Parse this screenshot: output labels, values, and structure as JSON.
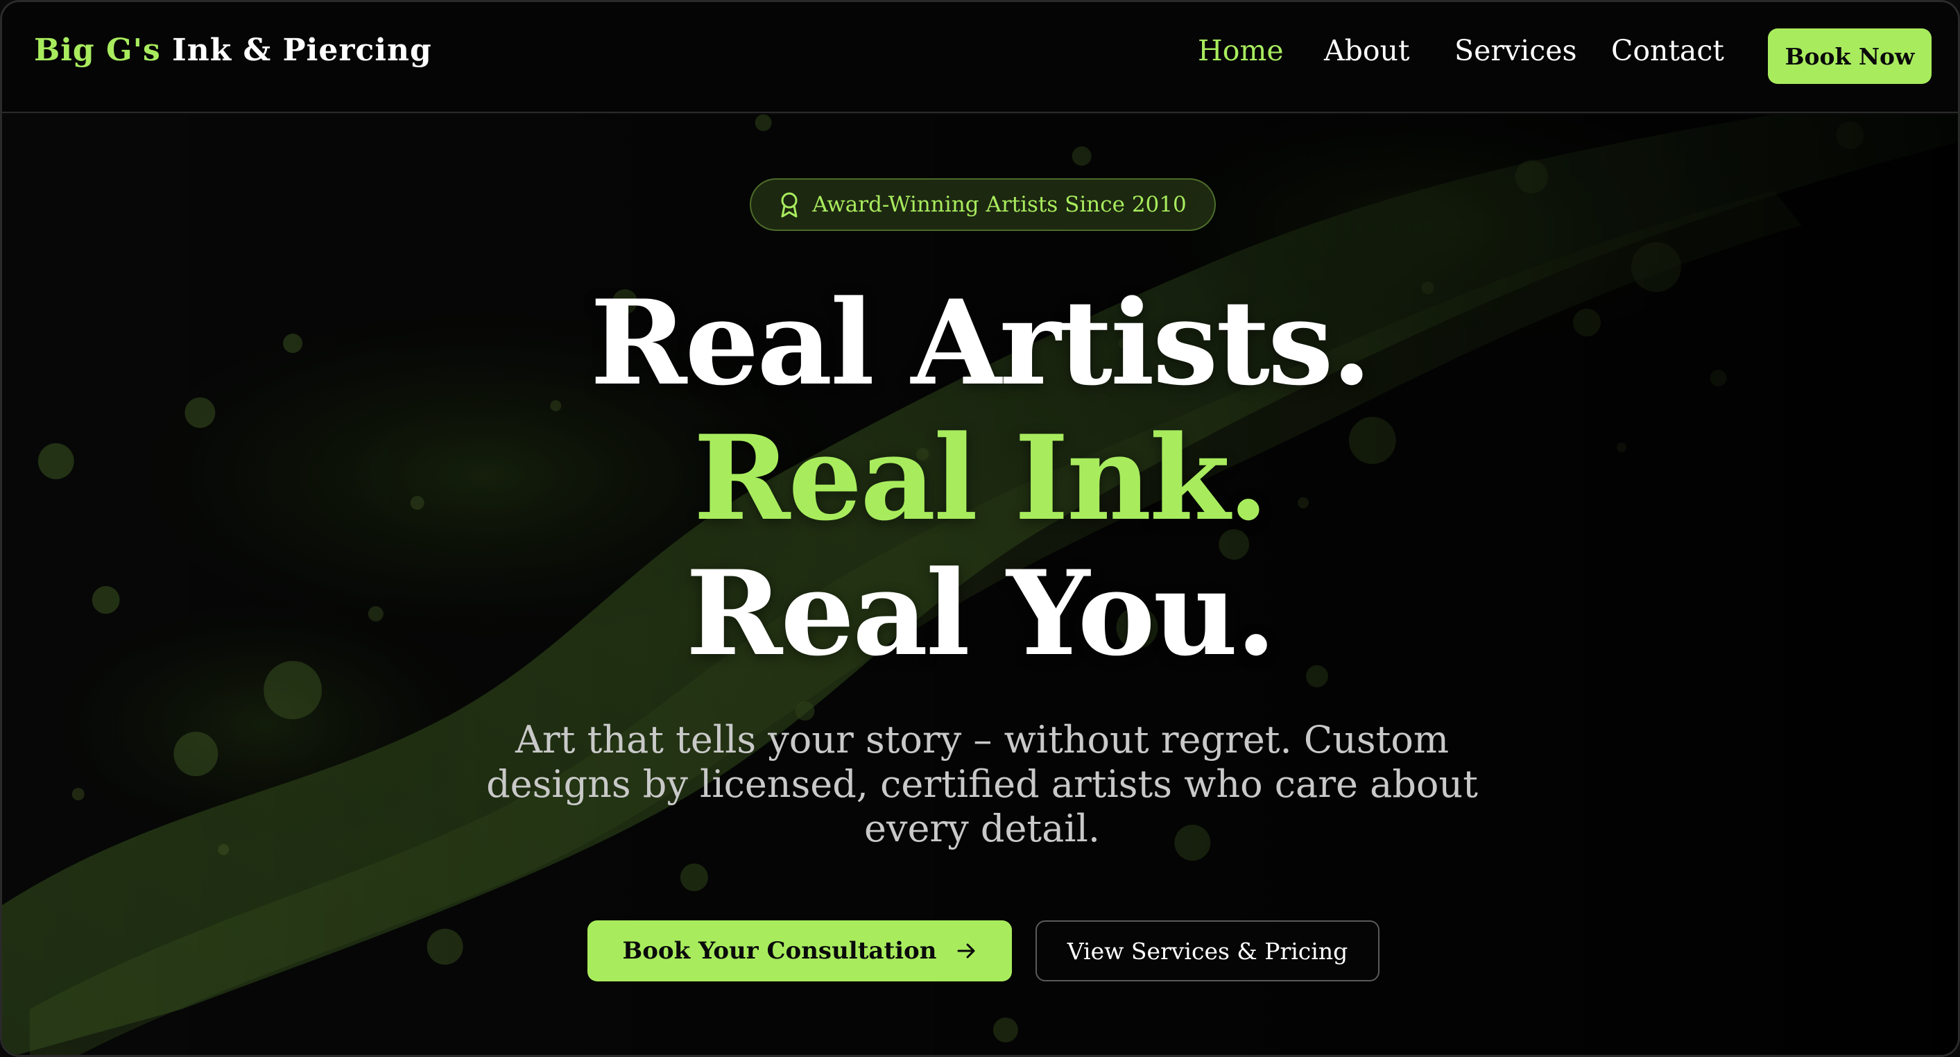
{
  "header": {
    "logo_accent": "Big G's",
    "logo_main": "Ink & Piercing",
    "nav": [
      {
        "label": "Home",
        "active": true
      },
      {
        "label": "About",
        "active": false
      },
      {
        "label": "Services",
        "active": false
      },
      {
        "label": "Contact",
        "active": false
      }
    ],
    "book_now_label": "Book Now"
  },
  "hero": {
    "badge_icon": "award-icon",
    "badge_text": "Award-Winning Artists Since 2010",
    "headline_1": "Real Artists.",
    "headline_2": "Real Ink.",
    "headline_3": "Real You.",
    "subtext": "Art that tells your story – without regret. Custom designs by licensed, certified artists who care about every detail.",
    "cta_primary_label": "Book Your Consultation",
    "cta_primary_icon": "arrow-right-icon",
    "cta_secondary_label": "View Services & Pricing"
  },
  "colors": {
    "accent": "#a8ec5e",
    "background": "#050505",
    "text": "#ffffff",
    "muted_text": "#c9c9c9"
  }
}
